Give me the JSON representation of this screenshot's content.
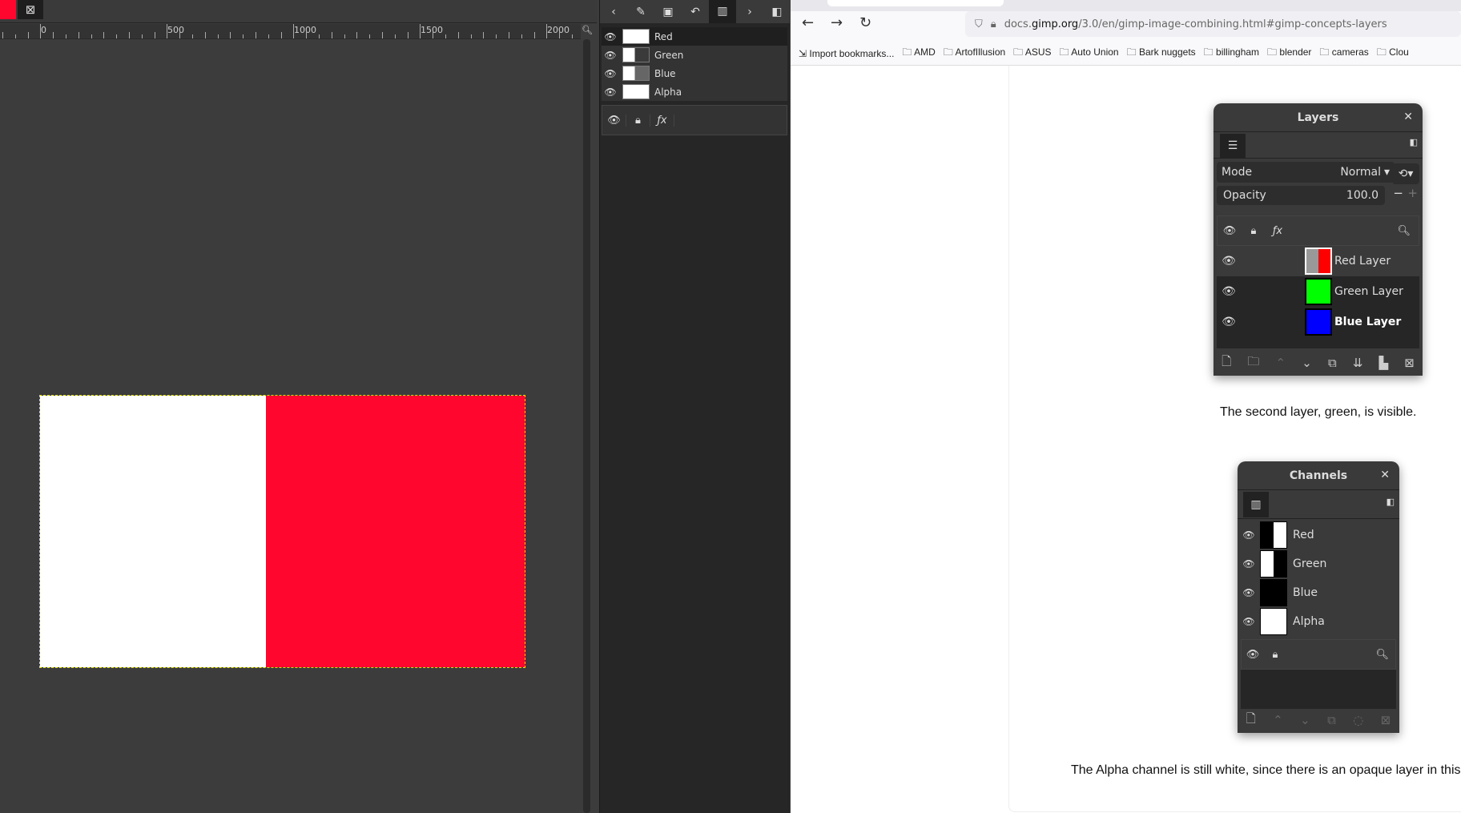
{
  "gimp": {
    "image_tab": {
      "close_icon": "close-box-icon"
    },
    "ruler": {
      "labels": [
        "0",
        "500",
        "1000",
        "1500",
        "2000"
      ]
    },
    "canvas_colors": {
      "left": "#ffffff",
      "right": "#ff062f"
    },
    "dock": {
      "tabs": [
        "‹",
        "brush-icon",
        "selection-icon",
        "undo-icon",
        "channels-icon",
        "›"
      ],
      "channels": [
        {
          "name": "Red"
        },
        {
          "name": "Green"
        },
        {
          "name": "Blue"
        },
        {
          "name": "Alpha"
        }
      ],
      "header_icons": [
        "eye-icon",
        "lock-icon",
        "fx-icon"
      ],
      "fx_label": "ƒx"
    }
  },
  "browser": {
    "url_host": "docs.gimp.org",
    "url_path": "/3.0/en/gimp-image-combining.html#gimp-concepts-layers",
    "url_prefix": "docs.",
    "url_domain": "gimp.org",
    "bookmarks": [
      "Import bookmarks...",
      "AMD",
      "ArtofIllusion",
      "ASUS",
      "Auto Union",
      "Bark nuggets",
      "billingham",
      "blender",
      "cameras",
      "Clou"
    ],
    "layers_dialog": {
      "title": "Layers",
      "mode_label": "Mode",
      "mode_value": "Normal",
      "opacity_label": "Opacity",
      "opacity_value": "100.0",
      "fx_label": "ƒx",
      "layers": [
        {
          "name": "Red Layer",
          "color": "#ff0000"
        },
        {
          "name": "Green Layer",
          "color": "#00ff00"
        },
        {
          "name": "Blue Layer",
          "color": "#0000ff"
        }
      ]
    },
    "caption1": "The second layer, green, is visible.",
    "channels_dialog": {
      "title": "Channels",
      "channels": [
        {
          "name": "Red"
        },
        {
          "name": "Green"
        },
        {
          "name": "Blue"
        },
        {
          "name": "Alpha"
        }
      ]
    },
    "caption2": "The Alpha channel is still white, since there is an opaque layer in this"
  }
}
